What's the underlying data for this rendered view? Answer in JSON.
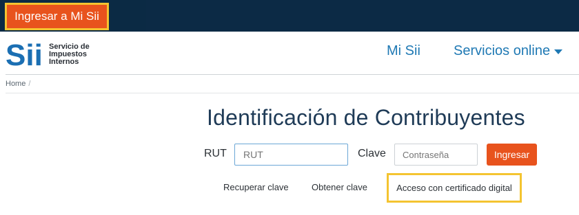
{
  "topbar": {
    "login_button_label": "Ingresar a Mi Sii"
  },
  "logo": {
    "mark_text": "Sii",
    "lines": [
      "Servicio de",
      "Impuestos",
      "Internos"
    ]
  },
  "nav": {
    "mi_sii": "Mi Sii",
    "servicios": "Servicios online"
  },
  "breadcrumb": {
    "home": "Home",
    "separator": "/"
  },
  "page": {
    "title": "Identificación de Contribuyentes"
  },
  "form": {
    "rut_label": "RUT",
    "rut_placeholder": "RUT",
    "clave_label": "Clave",
    "clave_placeholder": "Contraseña",
    "submit_label": "Ingresar"
  },
  "links": {
    "recuperar": "Recuperar clave",
    "obtener": "Obtener clave",
    "certificado": "Acceso con certificado digital"
  },
  "colors": {
    "topbar": "#0b2a44",
    "accent_orange": "#e8531d",
    "highlight_yellow": "#f4c430",
    "link_blue": "#1f79b4",
    "logo_blue": "#1b6fb3"
  },
  "icons": {
    "menu_caret": "caret-down-icon"
  }
}
